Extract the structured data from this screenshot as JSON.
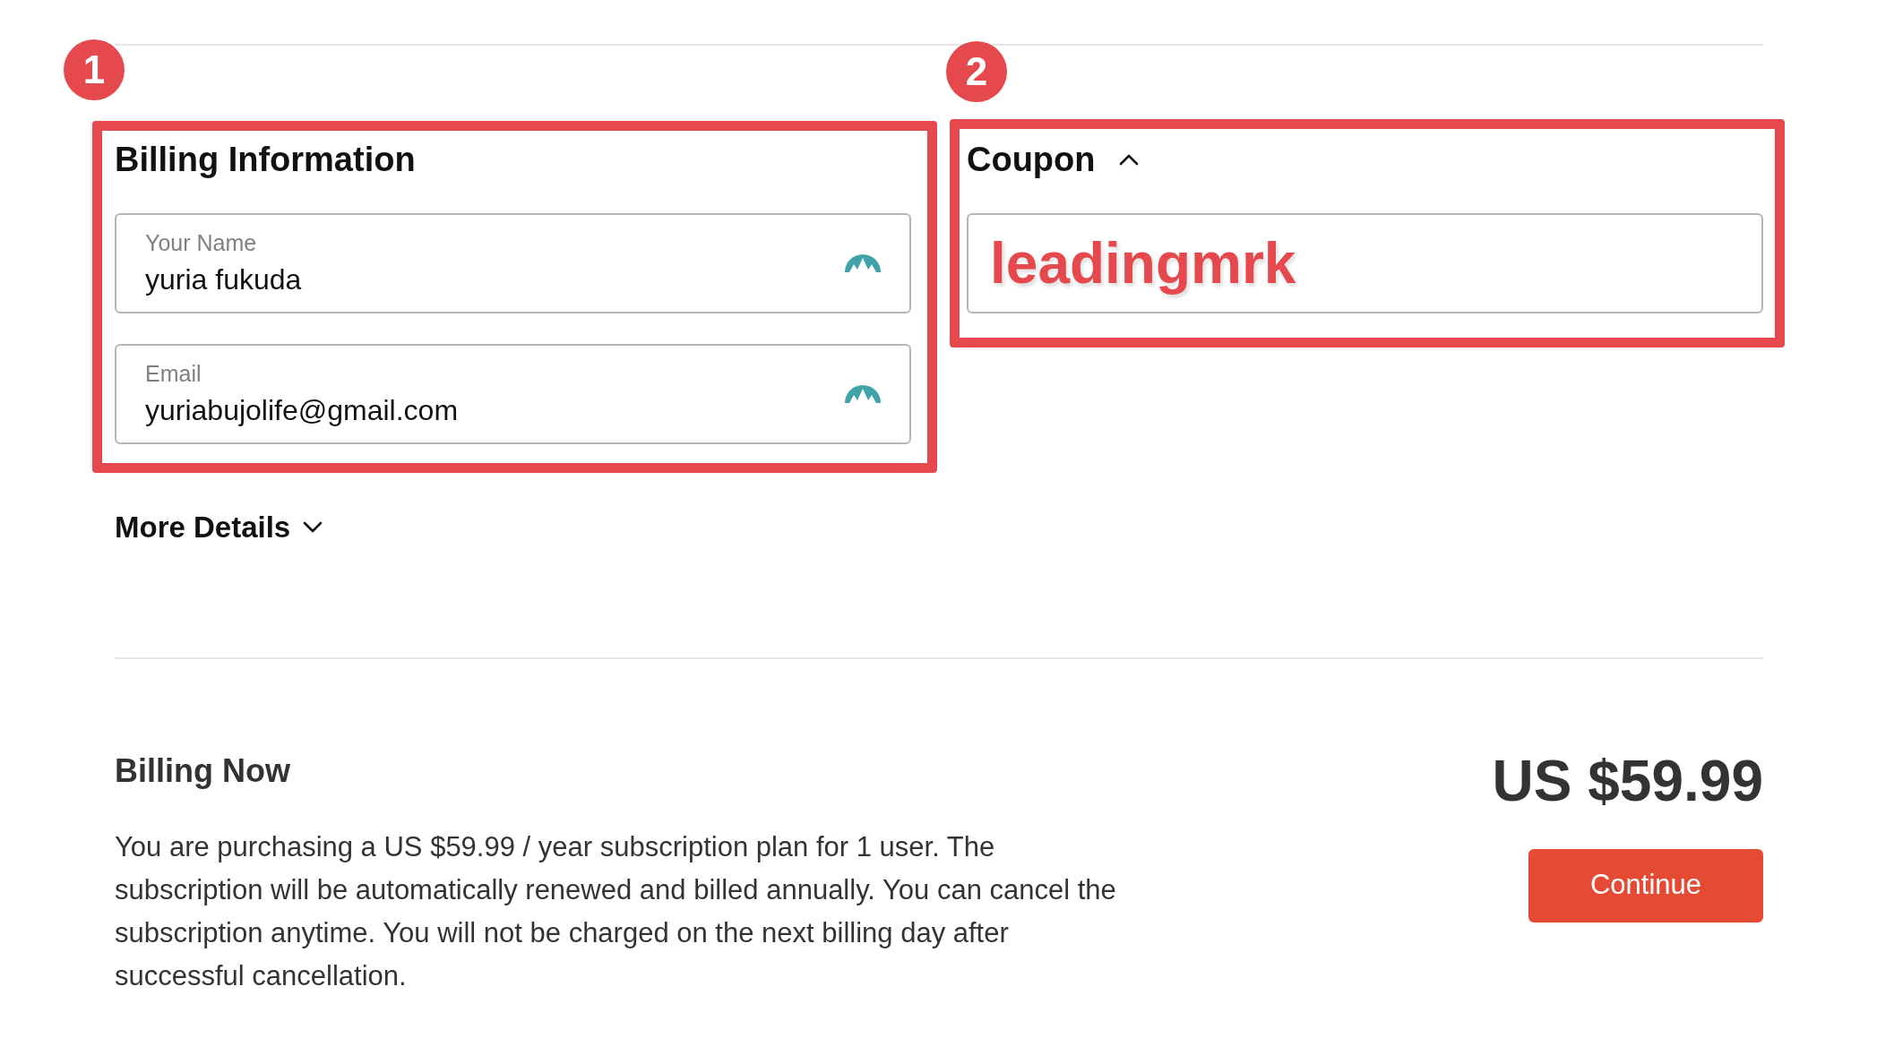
{
  "annotations": [
    {
      "number": "1"
    },
    {
      "number": "2"
    }
  ],
  "billing_information": {
    "title": "Billing Information",
    "fields": [
      {
        "label": "Your Name",
        "value": "yuria fukuda"
      },
      {
        "label": "Email",
        "value": "yuriabujolife@gmail.com"
      }
    ]
  },
  "more_details": {
    "label": "More Details",
    "expanded": false
  },
  "coupon": {
    "title": "Coupon",
    "expanded": true,
    "value": "leadingmrk"
  },
  "billing_now": {
    "title": "Billing Now",
    "description": "You are purchasing a US $59.99 / year subscription plan for 1 user. The subscription will be automatically renewed and billed annually. You can cancel the subscription anytime. You will not be charged on the next billing day after successful cancellation.",
    "price": "US $59.99",
    "button": "Continue"
  }
}
